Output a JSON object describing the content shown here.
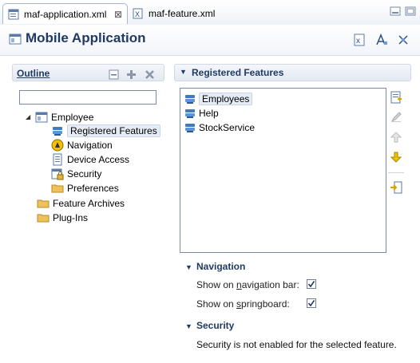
{
  "tabs": [
    {
      "label": "maf-application.xml",
      "active": true,
      "close": "⊠"
    },
    {
      "label": "maf-feature.xml",
      "active": false
    }
  ],
  "header": {
    "title": "Mobile Application"
  },
  "outline": {
    "title": "Outline",
    "search_value": "",
    "tree": [
      {
        "label": "Employee",
        "icon": "application-icon"
      },
      {
        "label": "Registered Features",
        "icon": "features-icon",
        "selected": true
      },
      {
        "label": "Navigation",
        "icon": "navigation-icon"
      },
      {
        "label": "Device Access",
        "icon": "device-icon"
      },
      {
        "label": "Security",
        "icon": "security-icon"
      },
      {
        "label": "Preferences",
        "icon": "folder-icon"
      },
      {
        "label": "Feature Archives",
        "icon": "folder-icon"
      },
      {
        "label": "Plug-Ins",
        "icon": "folder-icon"
      }
    ]
  },
  "registered": {
    "title": "Registered Features",
    "features": [
      "Employees",
      "Help",
      "StockService"
    ]
  },
  "navigation": {
    "title": "Navigation",
    "nav_bar_label": "Show on navigation bar:",
    "springboard_label": "Show on springboard:",
    "nav_bar_checked": true,
    "springboard_checked": true
  },
  "security": {
    "title": "Security",
    "message": "Security is not enabled for the selected feature."
  },
  "colors": {
    "title": "#1f3a63",
    "border": "#a9b7cd"
  }
}
